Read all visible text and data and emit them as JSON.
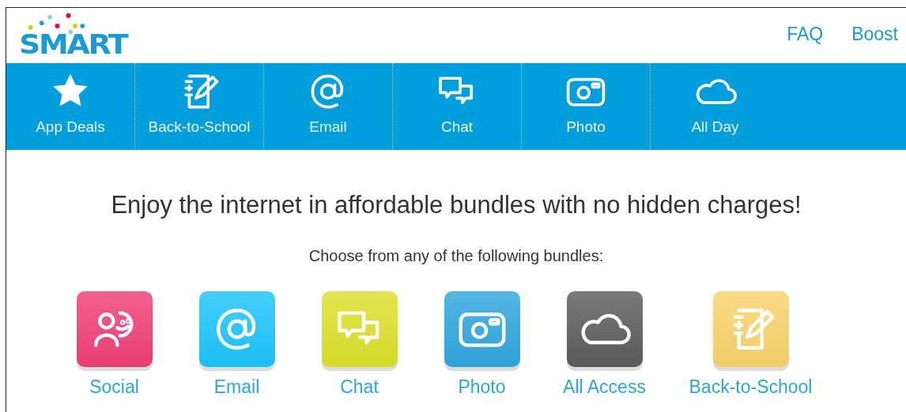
{
  "logo": {
    "text": "SMART"
  },
  "top_links": [
    "FAQ",
    "Boost"
  ],
  "nav": [
    {
      "label": "App Deals"
    },
    {
      "label": "Back-to-School"
    },
    {
      "label": "Email"
    },
    {
      "label": "Chat"
    },
    {
      "label": "Photo"
    },
    {
      "label": "All Day"
    }
  ],
  "headline": "Enjoy the internet in affordable bundles with no hidden charges!",
  "subtitle": "Choose from any of the following bundles:",
  "bundles": [
    {
      "label": "Social",
      "color": "#ef3f78"
    },
    {
      "label": "Email",
      "color": "#1cc4fb"
    },
    {
      "label": "Chat",
      "color": "#dbe02a"
    },
    {
      "label": "Photo",
      "color": "#2fa6dc"
    },
    {
      "label": "All Access",
      "color": "#5c5c5c"
    },
    {
      "label": "Back-to-School",
      "color": "#f8d36a"
    }
  ]
}
